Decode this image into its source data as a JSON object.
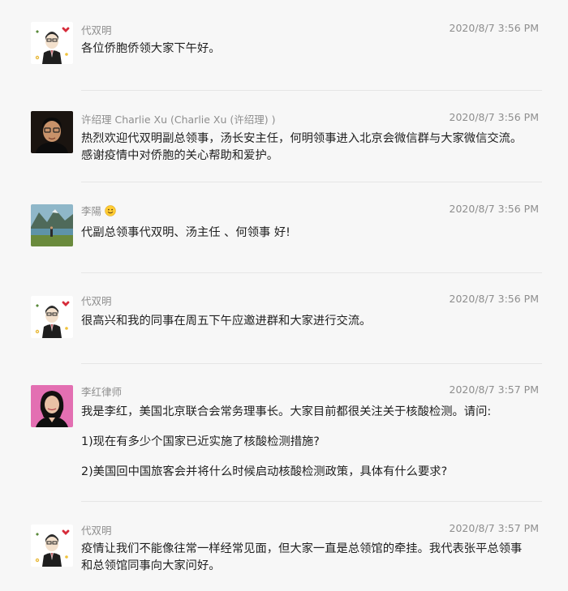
{
  "messages": [
    {
      "sender": "代双明",
      "time": "2020/8/7 3:56 PM",
      "avatar": "cartoon-man-avatar",
      "lines": [
        "各位侨胞侨领大家下午好。"
      ]
    },
    {
      "sender": "许绍理 Charlie Xu (Charlie Xu (许绍理) )",
      "time": "2020/8/7 3:56 PM",
      "avatar": "man-with-glasses-photo",
      "lines": [
        "热烈欢迎代双明副总领事，汤长安主任，何明领事进入北京会微信群与大家微信交流。感谢疫情中对侨胞的关心帮助和爱护。"
      ]
    },
    {
      "sender": "李陽",
      "sender_emoji": "smiling-face-emoji",
      "time": "2020/8/7 3:56 PM",
      "avatar": "mountain-lake-photo",
      "lines": [
        "代副总领事代双明、汤主任 、何领事 好!"
      ]
    },
    {
      "sender": "代双明",
      "time": "2020/8/7 3:56 PM",
      "avatar": "cartoon-man-avatar",
      "lines": [
        "很高兴和我的同事在周五下午应邀进群和大家进行交流。"
      ]
    },
    {
      "sender": "李红律师",
      "time": "2020/8/7 3:57 PM",
      "avatar": "woman-portrait-pink-photo",
      "lines": [
        "我是李红，美国北京联合会常务理事长。大家目前都很关注关于核酸检测。请问:",
        "1)现在有多少个国家已近实施了核酸检测措施?",
        "2)美国回中国旅客会并将什么时候启动核酸检测政策，具体有什么要求?"
      ]
    },
    {
      "sender": "代双明",
      "time": "2020/8/7 3:57 PM",
      "avatar": "cartoon-man-avatar",
      "lines": [
        "疫情让我们不能像往常一样经常见面，但大家一直是总领馆的牵挂。我代表张平总领事和总领馆同事向大家问好。"
      ]
    }
  ]
}
